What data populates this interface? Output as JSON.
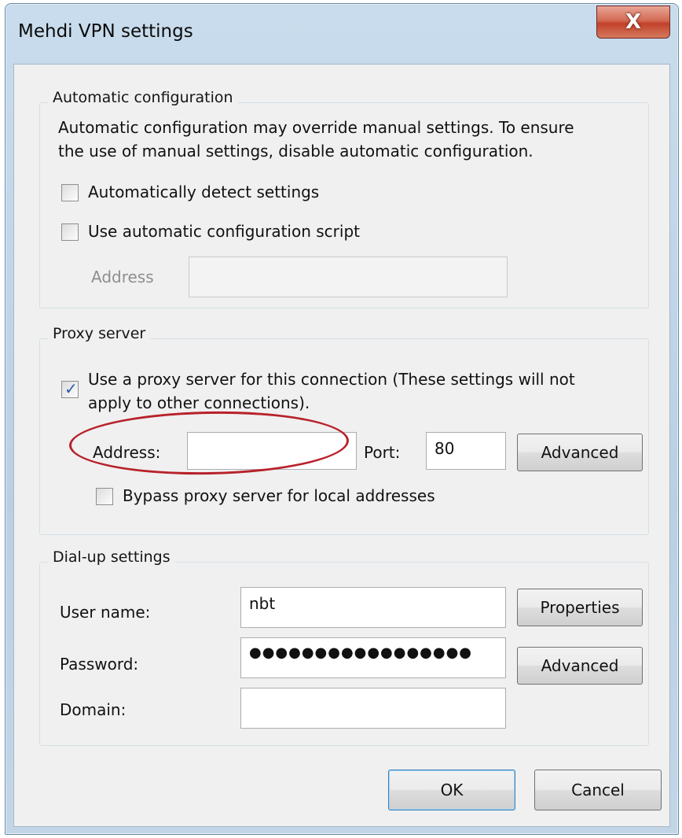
{
  "window": {
    "title": "Mehdi VPN settings",
    "close_glyph": "X"
  },
  "auto_config": {
    "title": "Automatic configuration",
    "description_line1": "Automatic configuration may override manual settings.  To ensure",
    "description_line2": "the use of manual settings, disable automatic configuration.",
    "detect_label": "Automatically detect settings",
    "detect_checked": false,
    "script_label": "Use automatic configuration script",
    "script_checked": false,
    "address_label": "Address",
    "address_value": ""
  },
  "proxy": {
    "title": "Proxy server",
    "use_label_line1": "Use a proxy server for this connection (These settings will not",
    "use_label_line2": "apply to other connections).",
    "use_checked": true,
    "address_label": "Address:",
    "address_value": "",
    "port_label": "Port:",
    "port_value": "80",
    "advanced_label": "Advanced",
    "bypass_label": "Bypass proxy server for local addresses",
    "bypass_checked": false,
    "highlight_color": "#b8212a"
  },
  "dialup": {
    "title": "Dial-up settings",
    "username_label": "User name:",
    "username_value": "nbt",
    "password_label": "Password:",
    "password_value": "●●●●●●●●●●●●●●●●●",
    "domain_label": "Domain:",
    "domain_value": "",
    "properties_label": "Properties",
    "advanced_label": "Advanced"
  },
  "footer": {
    "ok_label": "OK",
    "cancel_label": "Cancel"
  }
}
